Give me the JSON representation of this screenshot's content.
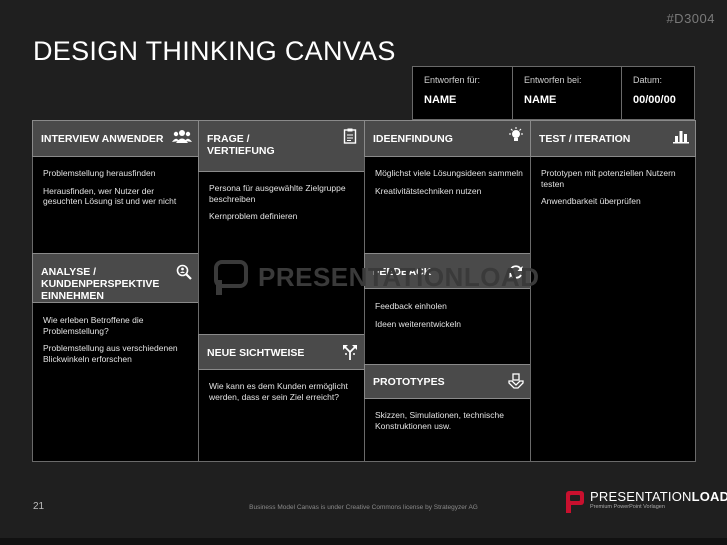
{
  "header": {
    "code": "#D3004",
    "title": "DESIGN THINKING CANVAS"
  },
  "meta": [
    {
      "label": "Entworfen für:",
      "value": "NAME"
    },
    {
      "label": "Entworfen bei:",
      "value": "NAME"
    },
    {
      "label": "Datum:",
      "value": "00/00/00"
    }
  ],
  "sections": {
    "interview": {
      "title": "INTERVIEW ANWENDER",
      "items": [
        "Problemstellung herausfinden",
        "Herausfinden, wer Nutzer der gesuchten Lösung ist und wer nicht"
      ]
    },
    "frage": {
      "title_line1": "FRAGE /",
      "title_line2": "VERTIEFUNG",
      "items": [
        "Persona für ausgewählte Zielgruppe beschreiben",
        "Kernproblem definieren"
      ]
    },
    "ideen": {
      "title": "IDEENFINDUNG",
      "items": [
        "Möglichst viele Lösungsideen sammeln",
        "Kreativitätstechniken nutzen"
      ]
    },
    "test": {
      "title": "TEST / ITERATION",
      "items": [
        "Prototypen mit potenziellen Nutzern testen",
        "Anwendbarkeit überprüfen"
      ]
    },
    "analyse": {
      "title_line1": "ANALYSE / KUNDENPERSPEKTIVE",
      "title_line2": "EINNEHMEN",
      "items": [
        "Wie erleben Betroffene die Problemstellung?",
        "Problemstellung aus verschiedenen Blickwinkeln erforschen"
      ]
    },
    "feedback": {
      "title": "FEEDBACK",
      "items": [
        "Feedback einholen",
        "Ideen weiterentwickeln"
      ]
    },
    "sichtweise": {
      "title": "NEUE SICHTWEISE",
      "items": [
        "Wie kann es dem Kunden ermöglicht werden, dass er sein Ziel erreicht?"
      ]
    },
    "prototypes": {
      "title": "PROTOTYPES",
      "items": [
        "Skizzen, Simulationen, technische Konstruktionen usw."
      ]
    }
  },
  "watermark": "PRESENTATIONLOAD",
  "footer": {
    "page": "21",
    "license": "Business Model Canvas is under Creative Commons license by Strategyzer AG",
    "logo_light": "PRESENTATION",
    "logo_bold": "LOAD",
    "logo_mark": "®",
    "logo_sub": "Premium PowerPoint Vorlagen"
  },
  "icons": {
    "interview": "people-icon",
    "frage": "clipboard-icon",
    "ideen": "lightbulb-icon",
    "test": "bar-chart-icon",
    "analyse": "magnifier-icon",
    "feedback": "refresh-icon",
    "sichtweise": "diverging-arrows-icon",
    "prototypes": "hand-box-icon"
  },
  "colors": {
    "background": "#1f1f1f",
    "cell": "#000000",
    "header": "#4a4a4a",
    "brand_red": "#c8102e"
  }
}
